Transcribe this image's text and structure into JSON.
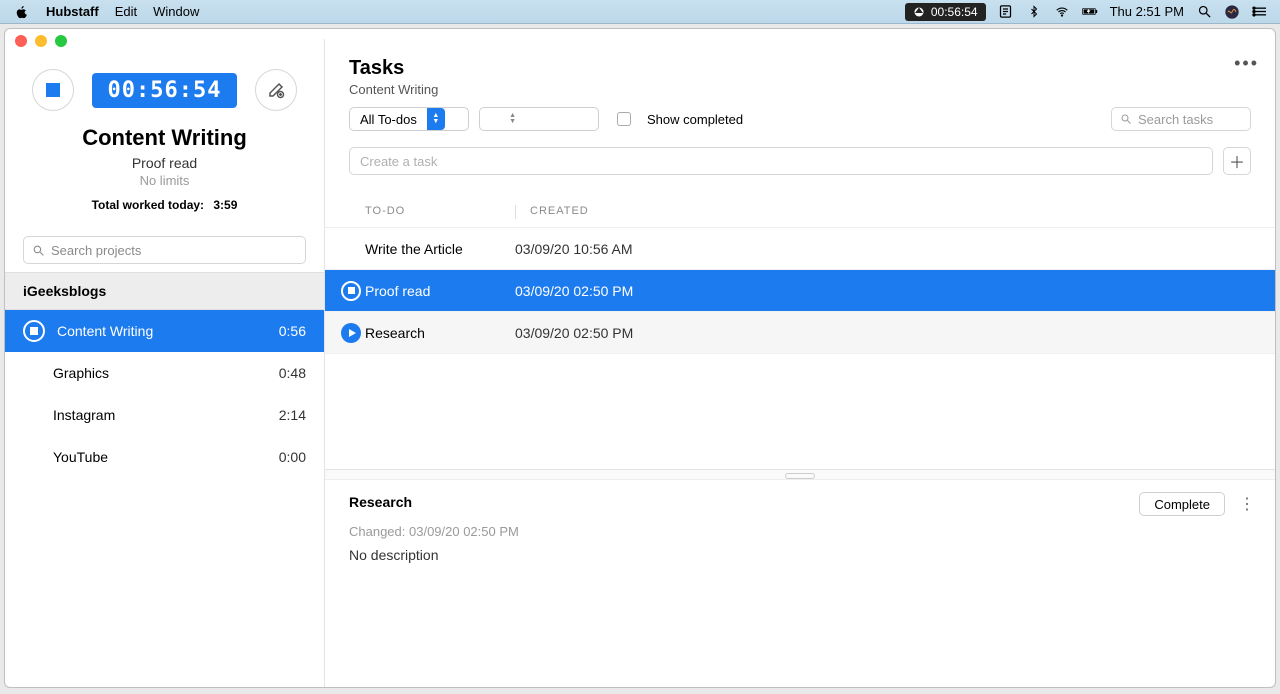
{
  "menubar": {
    "app": "Hubstaff",
    "items": [
      "Edit",
      "Window"
    ],
    "sync_time": "00:56:54",
    "clock": "Thu 2:51 PM"
  },
  "timer": {
    "elapsed": "00:56:54",
    "project": "Content Writing",
    "task": "Proof read",
    "limits": "No limits",
    "total_label": "Total worked today:",
    "total_value": "3:59"
  },
  "search_projects_placeholder": "Search projects",
  "org": "iGeeksblogs",
  "projects": [
    {
      "name": "Content Writing",
      "time": "0:56",
      "active": true
    },
    {
      "name": "Graphics",
      "time": "0:48",
      "active": false
    },
    {
      "name": "Instagram",
      "time": "2:14",
      "active": false
    },
    {
      "name": "YouTube",
      "time": "0:00",
      "active": false
    }
  ],
  "main": {
    "title": "Tasks",
    "subtitle": "Content Writing",
    "filter_select": "All To-dos",
    "show_completed_label": "Show completed",
    "search_tasks_placeholder": "Search tasks",
    "create_placeholder": "Create a task",
    "columns": {
      "todo": "TO-DO",
      "created": "CREATED"
    },
    "tasks": [
      {
        "todo": "Write the Article",
        "created": "03/09/20 10:56 AM",
        "state": "none"
      },
      {
        "todo": "Proof read",
        "created": "03/09/20 02:50 PM",
        "state": "active"
      },
      {
        "todo": "Research",
        "created": "03/09/20 02:50 PM",
        "state": "play"
      }
    ],
    "detail": {
      "title": "Research",
      "changed": "Changed: 03/09/20 02:50 PM",
      "description": "No description",
      "complete_label": "Complete"
    }
  }
}
